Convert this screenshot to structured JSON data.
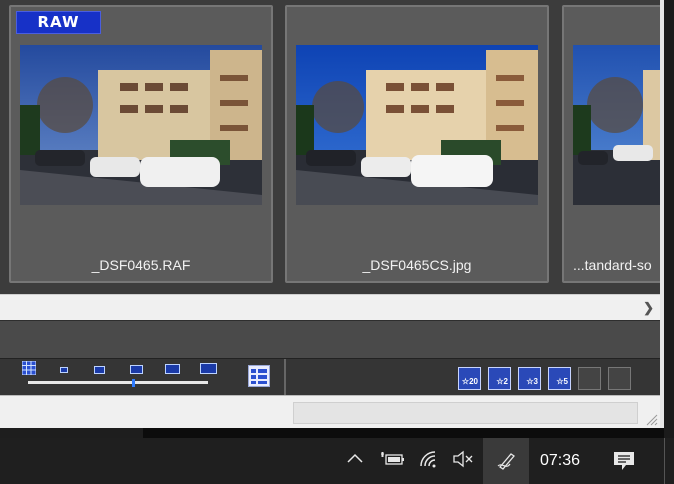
{
  "thumbnails": [
    {
      "badge": "RAW",
      "filename": "_DSF0465.RAF"
    },
    {
      "badge": "",
      "filename": "_DSF0465CS.jpg"
    },
    {
      "badge": "",
      "filename": "...tandard-so"
    }
  ],
  "toolbar": {
    "view_icons": [
      "grid-view-icon",
      "size-1-icon",
      "size-2-icon",
      "size-3-icon",
      "size-4-icon",
      "size-5-icon"
    ],
    "slider_value_percent": 58,
    "rating_buttons": [
      "☆20",
      "☆2",
      "☆3",
      "☆5",
      "",
      ""
    ]
  },
  "taskbar": {
    "clock": "07:36",
    "icons": [
      "chevron-up-icon",
      "battery-icon",
      "wifi-icon",
      "volume-muted-icon",
      "pen-icon",
      "notifications-icon"
    ]
  },
  "colors": {
    "accent": "#1731c7",
    "panel": "#5b5b5b",
    "background": "#3c3c3c"
  }
}
